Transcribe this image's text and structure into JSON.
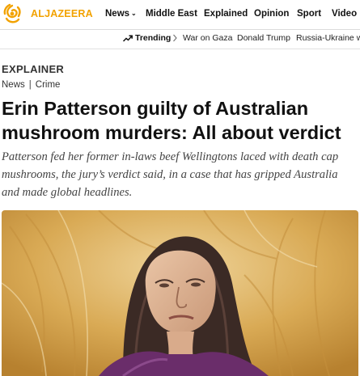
{
  "header": {
    "logo_text": "ALJAZEERA",
    "logo_icon": "al-jazeera-calligraphy-logo",
    "nav": [
      "News",
      "Middle East",
      "Explained",
      "Opinion",
      "Sport",
      "Video"
    ]
  },
  "trending": {
    "label": "Trending",
    "icon": "trending-up-icon",
    "links": [
      "War on Gaza",
      "Donald Trump",
      "Russia-Ukraine wa"
    ]
  },
  "article": {
    "kicker": "EXPLAINER",
    "crumbs": [
      "News",
      "Crime"
    ],
    "crumb_separator": "|",
    "headline": "Erin Patterson guilty of Australian mushroom murders: All about verdict",
    "dek": "Patterson fed her former in-laws beef Wellingtons laced with death cap mushrooms, the jury’s verdict said, in a case that has gripped Australia and made global headlines."
  },
  "colors": {
    "brand": "#f2a200",
    "text": "#111111",
    "dek": "#444444"
  }
}
